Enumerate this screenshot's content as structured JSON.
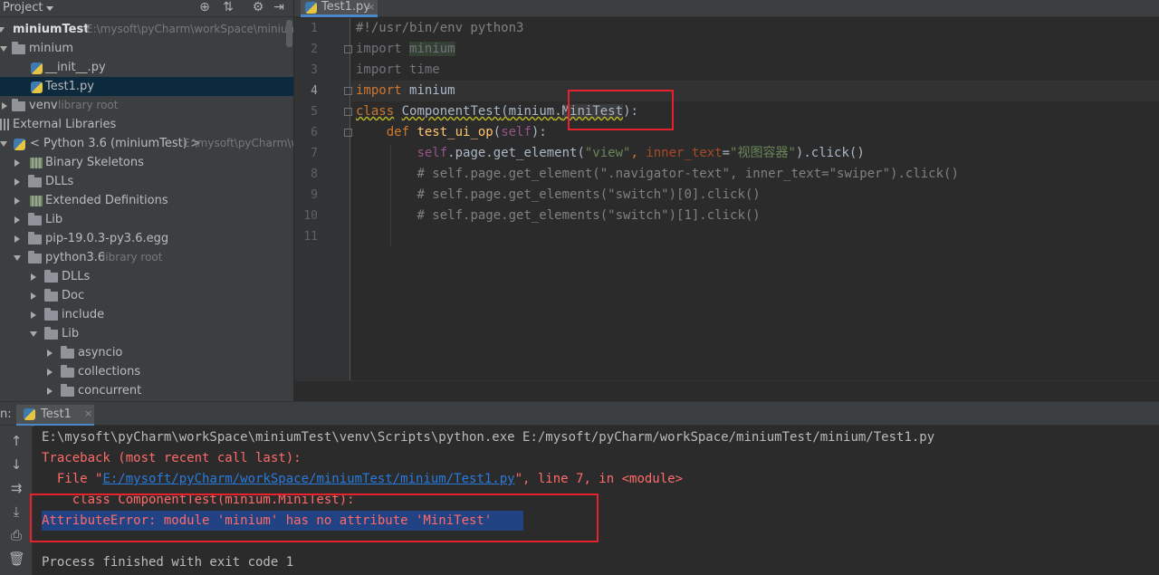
{
  "project_panel": {
    "title": "Project",
    "items": [
      {
        "label": "miniumTest",
        "hint": "E:\\mysoft\\pyCharm\\workSpace\\minium"
      },
      {
        "label": "minium"
      },
      {
        "label": "__init__.py"
      },
      {
        "label": "Test1.py"
      },
      {
        "label": "venv",
        "hint": "library root"
      },
      {
        "label": "External Libraries"
      },
      {
        "label": "< Python 3.6 (miniumTest) >",
        "hint": "E:\\mysoft\\pyCharm\\w"
      },
      {
        "label": "Binary Skeletons"
      },
      {
        "label": "DLLs"
      },
      {
        "label": "Extended Definitions"
      },
      {
        "label": "Lib"
      },
      {
        "label": "pip-19.0.3-py3.6.egg"
      },
      {
        "label": "python3.6",
        "hint": "library root"
      },
      {
        "label": "DLLs"
      },
      {
        "label": "Doc"
      },
      {
        "label": "include"
      },
      {
        "label": "Lib"
      },
      {
        "label": "asyncio"
      },
      {
        "label": "collections"
      },
      {
        "label": "concurrent"
      }
    ]
  },
  "editor": {
    "tab_label": "Test1.py",
    "tab_close": "×",
    "line_numbers": [
      "1",
      "2",
      "3",
      "4",
      "5",
      "6",
      "7",
      "8",
      "9",
      "10",
      "11"
    ],
    "lines": {
      "l1": "#!/usr/bin/env python3",
      "l2_kw": "import",
      "l2_mod": "minium",
      "l3_kw": "import",
      "l3_mod": "time",
      "l4_kw": "import",
      "l4_mod": "minium",
      "l5_kw": "class",
      "l5_name": "ComponentTest",
      "l5_open": "(",
      "l5_base": "minium",
      "l5_dot": ".",
      "l5_attr": "MiniTest",
      "l5_close": "):",
      "l6_kw": "def",
      "l6_fn": "test_ui_op",
      "l6_open": "(",
      "l6_self": "self",
      "l6_close": "):",
      "l7_self": "self",
      "l7_call": ".page.get_element(",
      "l7_str1": "\"view\"",
      "l7_comma": ", ",
      "l7_param": "inner_text",
      "l7_eq": "=",
      "l7_str2": "\"视图容器\"",
      "l7_end": ").click()",
      "l8": "# self.page.get_element(\".navigator-text\", inner_text=\"swiper\").click()",
      "l9": "# self.page.get_elements(\"switch\")[0].click()",
      "l10": "# self.page.get_elements(\"switch\")[1].click()"
    }
  },
  "run_panel": {
    "prefix": "n:",
    "tab_label": "Test1",
    "tab_close": "×",
    "output": {
      "cmd": "E:\\mysoft\\pyCharm\\workSpace\\miniumTest\\venv\\Scripts\\python.exe E:/mysoft/pyCharm/workSpace/miniumTest/minium/Test1.py",
      "traceback": "Traceback (most recent call last):",
      "file_prefix": "  File \"",
      "file_link": "E:/mysoft/pyCharm/workSpace/miniumTest/minium/Test1.py",
      "file_suffix": "\", line 7, in <module>",
      "code": "    class ComponentTest(minium.MiniTest):",
      "error": "AttributeError: module 'minium' has no attribute 'MiniTest'",
      "exit": "Process finished with exit code 1"
    }
  },
  "colors": {
    "keyword": "#cc7832",
    "string": "#6a8759",
    "comment": "#808080",
    "error_text": "#ff6b68",
    "annotation_box": "#e8212f",
    "selection": "#214283"
  }
}
